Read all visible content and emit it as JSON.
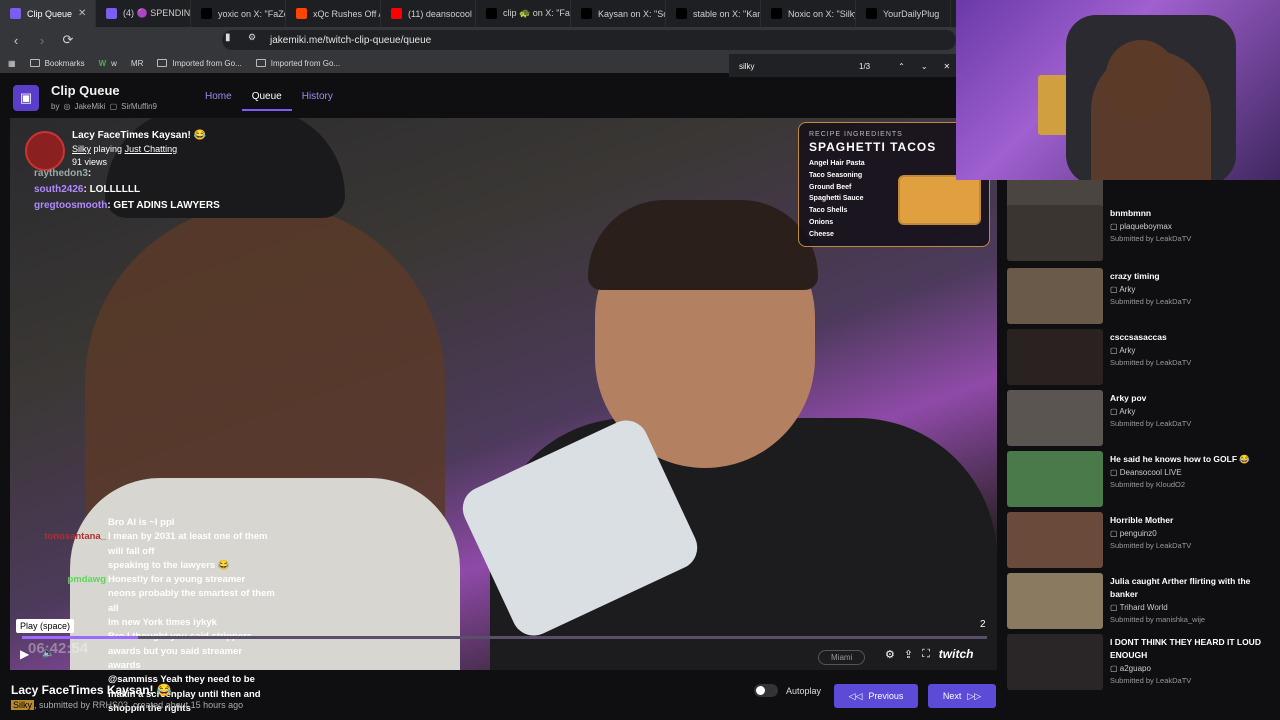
{
  "browser": {
    "tabs": [
      {
        "label": "Clip Queue",
        "fav_color": "#7b5cf5",
        "active": true
      },
      {
        "label": "(4) 🟣 SPENDING",
        "fav_color": "#7b5cf5"
      },
      {
        "label": "yoxic on X: \"FaZe",
        "fav_color": "#000000"
      },
      {
        "label": "xQc Rushes Off A",
        "fav_color": "#ff4500"
      },
      {
        "label": "(11) deansocool",
        "fav_color": "#ff0000"
      },
      {
        "label": "clip 🐢 on X: \"Fa",
        "fav_color": "#000000"
      },
      {
        "label": "Kaysan on X: \"So",
        "fav_color": "#000000"
      },
      {
        "label": "stable on X: \"Kam",
        "fav_color": "#000000"
      },
      {
        "label": "Noxic on X: \"Silky",
        "fav_color": "#000000"
      },
      {
        "label": "YourDailyPlug",
        "fav_color": "#000000"
      }
    ],
    "url": "jakemiki.me/twitch-clip-queue/queue",
    "bookmarks": [
      "Bookmarks",
      "w",
      "MR",
      "Imported from Go...",
      "Imported from Go..."
    ],
    "find": {
      "query": "silky",
      "count": "1/3"
    }
  },
  "app": {
    "title": "Clip Queue",
    "by": "by",
    "author1": "JakeMiki",
    "author2": "SirMuffin9",
    "nav": [
      "Home",
      "Queue",
      "History"
    ]
  },
  "player": {
    "clip_title": "Lacy FaceTimes Kaysan! 😂",
    "streamer": "Silky",
    "playing": "playing",
    "category": "Just Chatting",
    "views": "91 views",
    "chat_top": [
      {
        "name": "raythedon3",
        "msg": ":"
      },
      {
        "name": "south2426",
        "msg": ": LOLLLLLL"
      },
      {
        "name": "gregtoosmooth",
        "msg": ": GET ADINS LAWYERS"
      }
    ],
    "recipe": {
      "header": "RECIPE INGREDIENTS",
      "title": "SPAGHETTI TACOS",
      "items": [
        "Angel Hair Pasta",
        "Taco Seasoning",
        "Ground Beef",
        "Spaghetti Sauce",
        "Taco Shells",
        "Onions",
        "Cheese"
      ]
    },
    "chat_bottom": [
      {
        "name": "",
        "msg": "Bro AI is ~I ppl"
      },
      {
        "name": "tonosantana_",
        "msg": "I mean by 2031 at least one of them will fall off"
      },
      {
        "name": "",
        "msg": "speaking to the lawyers 😂"
      },
      {
        "name": "pmdawg",
        "msg": "Honestly for a young streamer neons probably the smartest of them all"
      },
      {
        "name": "",
        "msg": "Im new York times iykyk"
      },
      {
        "name": "",
        "msg": "Bro I thought you said strippers awards but you said streamer awards"
      },
      {
        "name": "",
        "msg": "@sammiss Yeah they need to be makin a screenplay until then and shoppin the rights"
      }
    ],
    "tooltip": "Play (space)",
    "time": "06:42:54",
    "location": "Miami",
    "clip_number": "2",
    "progress": 0.12,
    "brand": "twitch"
  },
  "below": {
    "title": "Lacy FaceTimes Kaysan! 😂",
    "streamer": "Silky",
    "submitted": ", submitted by RRHS03, created about 15 hours ago",
    "autoplay_label": "Autoplay",
    "prev_label": "Previous",
    "next_label": "Next"
  },
  "queue": [
    {
      "title": "",
      "channel": "",
      "submitter": "Submitted by LeakDaTV",
      "thumb": "#4a4540"
    },
    {
      "title": "bnmbmnn",
      "channel": "plaqueboymax",
      "submitter": "Submitted by LeakDaTV",
      "thumb": "#3a3530"
    },
    {
      "title": "crazy timing",
      "channel": "Arky",
      "submitter": "Submitted by LeakDaTV",
      "thumb": "#6a5a4a"
    },
    {
      "title": "csccsasaccas",
      "channel": "Arky",
      "submitter": "Submitted by LeakDaTV",
      "thumb": "#2a2220"
    },
    {
      "title": "Arky pov",
      "channel": "Arky",
      "submitter": "Submitted by LeakDaTV",
      "thumb": "#5a5550"
    },
    {
      "title": "He said he knows how to GOLF 😂",
      "channel": "Deansocool LIVE",
      "submitter": "Submitted by KloudO2",
      "thumb": "#4a7a4a"
    },
    {
      "title": "Horrible Mother",
      "channel": "penguinz0",
      "submitter": "Submitted by LeakDaTV",
      "thumb": "#6a4a3a"
    },
    {
      "title": "Julia caught Arther flirting with the banker",
      "channel": "Trihard World",
      "submitter": "Submitted by manishka_wije",
      "thumb": "#8a7a60"
    },
    {
      "title": "I DONT THINK THEY HEARD IT LOUD ENOUGH",
      "channel": "a2guapo",
      "submitter": "Submitted by LeakDaTV",
      "thumb": "#2a2628"
    }
  ],
  "colors": {
    "accent": "#7b5cf5",
    "button": "#5b4bd6",
    "bg": "#0f0f12"
  }
}
